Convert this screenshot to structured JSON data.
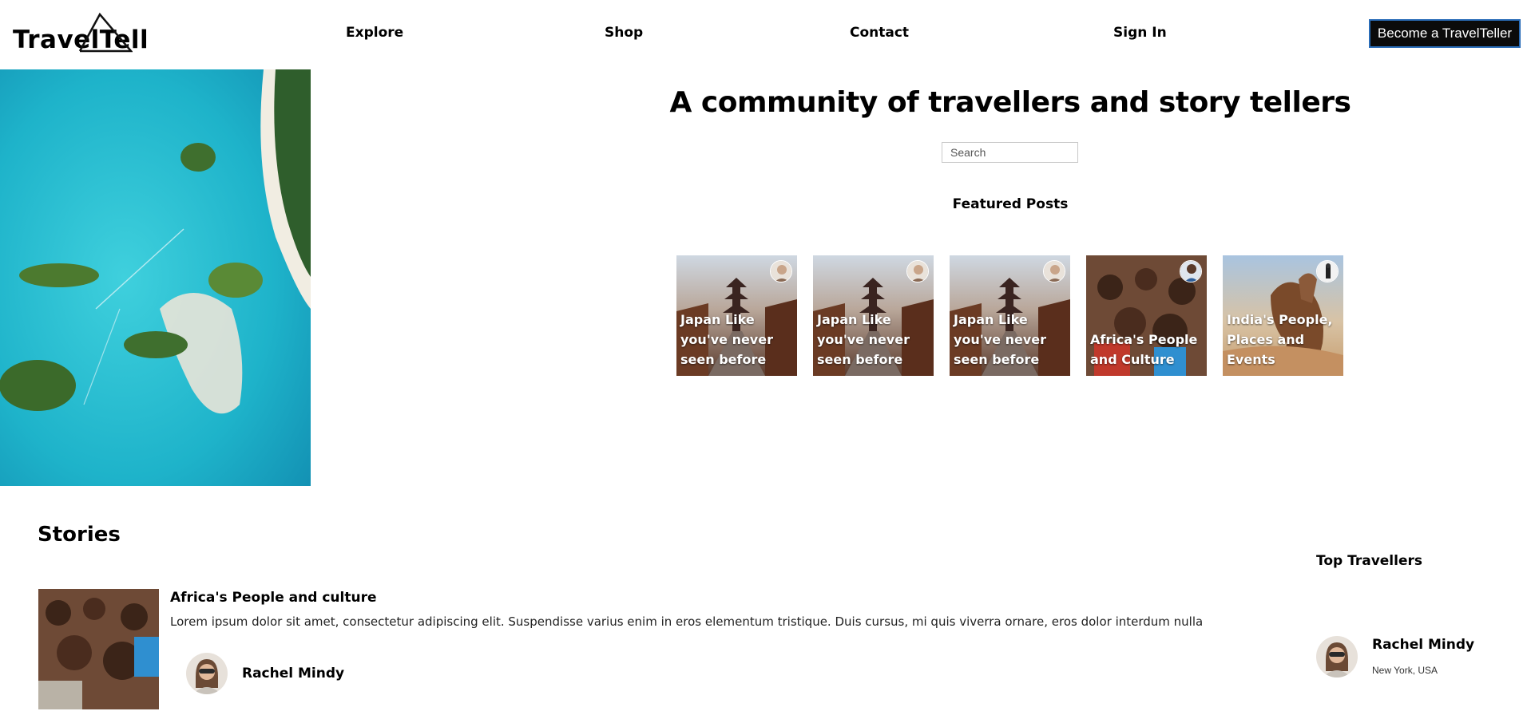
{
  "header": {
    "logo_text": "TravelTell",
    "nav": [
      "Explore",
      "Shop",
      "Contact",
      "Sign In"
    ],
    "cta_label": "Become a TravelTeller"
  },
  "hero": {
    "tagline": "A community of travellers and story tellers",
    "search_placeholder": "Search"
  },
  "featured": {
    "heading": "Featured Posts",
    "posts": [
      {
        "title": "Japan Like you've never seen before",
        "image": "kyoto-street"
      },
      {
        "title": "Japan Like you've never seen before",
        "image": "kyoto-street"
      },
      {
        "title": "Japan Like you've never seen before",
        "image": "kyoto-street"
      },
      {
        "title": "Africa's People and Culture",
        "image": "children-crowd"
      },
      {
        "title": "India's People, Places and Events",
        "image": "camel-desert"
      }
    ]
  },
  "stories": {
    "heading": "Stories",
    "items": [
      {
        "title": "Africa's People and culture",
        "excerpt": "Lorem ipsum dolor sit amet, consectetur adipiscing elit. Suspendisse varius enim in eros elementum tristique. Duis cursus, mi quis viverra ornare, eros dolor interdum nulla",
        "author": "Rachel Mindy"
      }
    ]
  },
  "top_travellers": {
    "heading": "Top Travellers",
    "items": [
      {
        "name": "Rachel Mindy",
        "location": "New York, USA"
      }
    ]
  },
  "colors": {
    "cta_bg": "#0b0b0b",
    "cta_border": "#2a6db8",
    "sea": "#1fb2c9"
  }
}
